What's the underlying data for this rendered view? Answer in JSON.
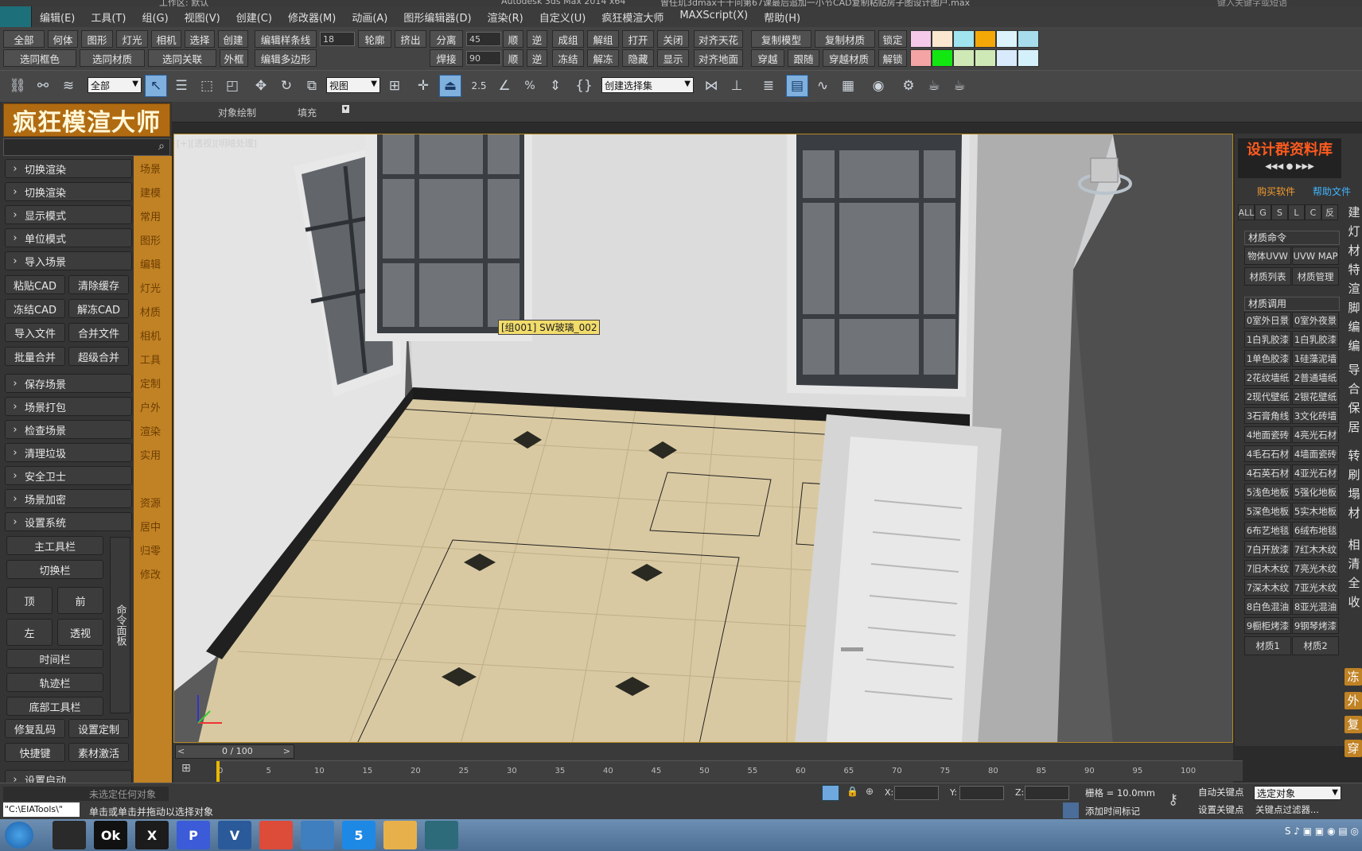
{
  "title": {
    "workspace": "工作区: 默认",
    "app": "Autodesk 3ds Max  2014 x64",
    "file": "曾任玑3dmax千千问第67课最后追加一小节CAD复制粘贴房子图设计图户.max",
    "search_placeholder": "键入关键字或短语"
  },
  "menubar": [
    "编辑(E)",
    "工具(T)",
    "组(G)",
    "视图(V)",
    "创建(C)",
    "修改器(M)",
    "动画(A)",
    "图形编辑器(D)",
    "渲染(R)",
    "自定义(U)",
    "疯狂模渲大师",
    "MAXScript(X)",
    "帮助(H)"
  ],
  "cmdbar": {
    "row1": [
      "全部",
      "何体",
      "图形",
      "灯光",
      "相机",
      "选择",
      "创建"
    ],
    "row2": [
      "选同框色",
      "选同材质",
      "选同关联",
      "外框"
    ],
    "edit_spline": "编辑样条线",
    "edit_poly": "编辑多边形",
    "spin1": "18",
    "spin2": "45",
    "spin3": "90",
    "mid1": [
      "轮廓",
      "挤出",
      "分离",
      "顺",
      "逆"
    ],
    "mid2": [
      "焊接",
      "顺",
      "逆"
    ],
    "grp1": [
      "成组",
      "解组",
      "打开",
      "关闭",
      "对齐天花"
    ],
    "grp2": [
      "冻结",
      "解冻",
      "隐藏",
      "显示",
      "对齐地面"
    ],
    "copy1": [
      "复制模型",
      "复制材质",
      "锁定"
    ],
    "copy2": [
      "穿越",
      "跟随",
      "穿越材质",
      "解锁"
    ],
    "swatches1": [
      "#f4c9ea",
      "#fbe7cf",
      "#9fe4ef",
      "#f4a808",
      "#dcf3fb",
      "#a6dceb"
    ],
    "swatches2": [
      "#f4a4a4",
      "#12e712",
      "#cfe9b6",
      "#cfe9b6",
      "#d8eafb",
      "#d4f0fb"
    ]
  },
  "toolbar": {
    "filter": "全部",
    "view": "视图",
    "selset": "创建选择集",
    "snap_angle": "2.5"
  },
  "ribbon": [
    "对象绘制",
    "填充"
  ],
  "leftpanel": {
    "brand": "疯狂模渲大师",
    "rows": [
      "切换渲染",
      "切换渲染",
      "显示模式",
      "单位模式",
      "导入场景"
    ],
    "pairs": [
      [
        "粘贴CAD",
        "清除缓存"
      ],
      [
        "冻结CAD",
        "解冻CAD"
      ],
      [
        "导入文件",
        "合并文件"
      ],
      [
        "批量合并",
        "超级合并"
      ]
    ],
    "rows2": [
      "保存场景",
      "场景打包",
      "检查场景",
      "清理垃圾",
      "安全卫士",
      "场景加密",
      "设置系统"
    ],
    "tools": [
      "主工具栏",
      "切换栏"
    ],
    "views": [
      [
        "顶",
        "前"
      ],
      [
        "左",
        "透视"
      ]
    ],
    "tools2": [
      "时间栏",
      "轨迹栏",
      "底部工具栏"
    ],
    "pairs2": [
      [
        "修复乱码",
        "设置定制"
      ],
      [
        "快捷键",
        "素材激活"
      ]
    ],
    "bottom": "设置启动",
    "cmdpanel": "命令面板",
    "categories": [
      "场景",
      "建模",
      "常用",
      "图形",
      "编辑",
      "灯光",
      "材质",
      "相机",
      "工具",
      "定制",
      "户外",
      "渲染",
      "实用",
      "资源",
      "居中",
      "归零",
      "修改"
    ]
  },
  "viewport": {
    "label": "[+][透视][明暗处理]",
    "tooltip": "[组001] SW玻璃_002"
  },
  "rightpanel": {
    "header": "设计群资料库",
    "links": [
      "购买软件",
      "帮助文件"
    ],
    "tabs": [
      "ALL",
      "G",
      "S",
      "L",
      "C",
      "反"
    ],
    "sec1": "材质命令",
    "cmds": [
      [
        "物体UVW",
        "UVW MAP"
      ],
      [
        "材质列表",
        "材质管理"
      ]
    ],
    "sec2": "材质调用",
    "mats": [
      [
        "0室外日景",
        "0室外夜景"
      ],
      [
        "1白乳胶漆",
        "1白乳胶漆"
      ],
      [
        "1单色胶漆",
        "1硅藻泥墙"
      ],
      [
        "2花纹墙纸",
        "2普通墙纸"
      ],
      [
        "2现代壁纸",
        "2银花壁纸"
      ],
      [
        "3石膏角线",
        "3文化砖墙"
      ],
      [
        "4地面瓷砖",
        "4亮光石材"
      ],
      [
        "4毛石石材",
        "4墙面瓷砖"
      ],
      [
        "4石英石材",
        "4亚光石材"
      ],
      [
        "5浅色地板",
        "5强化地板"
      ],
      [
        "5深色地板",
        "5实木地板"
      ],
      [
        "6布艺地毯",
        "6绒布地毯"
      ],
      [
        "7白开放漆",
        "7红木木纹"
      ],
      [
        "7旧木木纹",
        "7亮光木纹"
      ],
      [
        "7深木木纹",
        "7亚光木纹"
      ],
      [
        "8白色混油",
        "8亚光混油"
      ],
      [
        "9橱柜烤漆",
        "9钢琴烤漆"
      ]
    ],
    "bottom": [
      "材质1",
      "材质2"
    ],
    "side_chars": [
      "建",
      "灯",
      "材",
      "特",
      "渲",
      "脚",
      "编",
      "编",
      "导",
      "合",
      "保",
      "居",
      "转",
      "刷",
      "塌",
      "材",
      "相",
      "清",
      "全",
      "收"
    ],
    "side_yellow": [
      "冻",
      "外",
      "复",
      "穿"
    ]
  },
  "timeline": {
    "frame": "0 / 100",
    "ticks": [
      "0",
      "5",
      "10",
      "15",
      "20",
      "25",
      "30",
      "35",
      "40",
      "45",
      "50",
      "55",
      "60",
      "65",
      "70",
      "75",
      "80",
      "85",
      "90",
      "95",
      "100"
    ]
  },
  "statusbar": {
    "selection": "未选定任何对象",
    "prompt": "单击或单击并拖动以选择对象",
    "path": "\"C:\\EIATools\\\"",
    "x": "X:",
    "y": "Y:",
    "z": "Z:",
    "grid": "栅格 = 10.0mm",
    "auto_key": "自动关键点",
    "set_key": "设置关键点",
    "sel_obj": "选定对象",
    "key_filter": "关键点过滤器...",
    "add_time": "添加时间标记"
  },
  "taskbar": [
    "",
    "Ok",
    "X",
    "P",
    "V",
    "",
    "",
    "5",
    "",
    ""
  ]
}
